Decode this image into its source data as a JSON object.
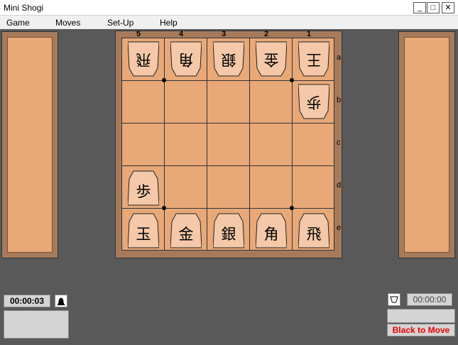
{
  "window": {
    "title": "Mini Shogi",
    "controls": {
      "minimize": "_",
      "maximize": "□",
      "close": "✕"
    }
  },
  "menu": {
    "items": [
      {
        "label": "Game"
      },
      {
        "label": "Moves"
      },
      {
        "label": "Set-Up"
      },
      {
        "label": "Help"
      }
    ]
  },
  "board": {
    "file_labels": [
      "5",
      "4",
      "3",
      "2",
      "1"
    ],
    "rank_labels": [
      "a",
      "b",
      "c",
      "d",
      "e"
    ],
    "colors": {
      "board": "#e8a878",
      "frame": "#a67b5b",
      "piece": "#f4c8a8",
      "lines": "#333333"
    },
    "pieces": [
      {
        "kanji": "飛",
        "name": "rook",
        "owner": "white",
        "row": 0,
        "col": 0
      },
      {
        "kanji": "角",
        "name": "bishop",
        "owner": "white",
        "row": 0,
        "col": 1
      },
      {
        "kanji": "銀",
        "name": "silver",
        "owner": "white",
        "row": 0,
        "col": 2
      },
      {
        "kanji": "金",
        "name": "gold",
        "owner": "white",
        "row": 0,
        "col": 3
      },
      {
        "kanji": "王",
        "name": "king",
        "owner": "white",
        "row": 0,
        "col": 4
      },
      {
        "kanji": "歩",
        "name": "pawn",
        "owner": "white",
        "row": 1,
        "col": 4
      },
      {
        "kanji": "歩",
        "name": "pawn",
        "owner": "black",
        "row": 3,
        "col": 0
      },
      {
        "kanji": "玉",
        "name": "king",
        "owner": "black",
        "row": 4,
        "col": 0
      },
      {
        "kanji": "金",
        "name": "gold",
        "owner": "black",
        "row": 4,
        "col": 1
      },
      {
        "kanji": "銀",
        "name": "silver",
        "owner": "black",
        "row": 4,
        "col": 2
      },
      {
        "kanji": "角",
        "name": "bishop",
        "owner": "black",
        "row": 4,
        "col": 3
      },
      {
        "kanji": "飛",
        "name": "rook",
        "owner": "black",
        "row": 4,
        "col": 4
      }
    ]
  },
  "clocks": {
    "black_time": "00:00:03",
    "white_time": "00:00:00"
  },
  "status": {
    "text": "Black to Move",
    "color": "#ee0000"
  },
  "icons": {
    "black_turn": "filled-bell-icon",
    "white_turn": "outline-bell-icon"
  }
}
